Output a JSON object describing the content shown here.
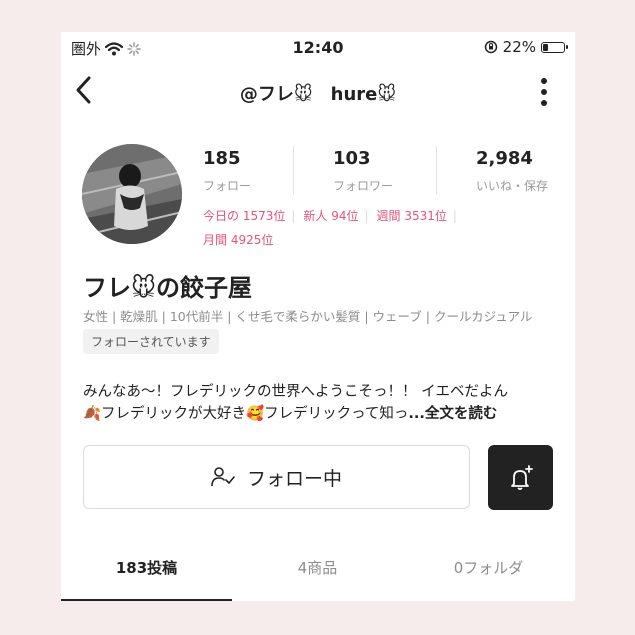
{
  "status_bar": {
    "carrier": "圏外",
    "time": "12:40",
    "battery": "22%",
    "battery_level": 0.22
  },
  "nav": {
    "title": "@フレ🐭　hure🐭",
    "back_icon": "chevron-left-icon",
    "more_icon": "more-vertical-icon"
  },
  "profile": {
    "stats": [
      {
        "num": "185",
        "label": "フォロー"
      },
      {
        "num": "103",
        "label": "フォロワー"
      },
      {
        "num": "2,984",
        "label": "いいね・保存"
      }
    ],
    "ranks": [
      "今日の 1573位",
      "新人 94位",
      "週間 3531位",
      "月間 4925位"
    ],
    "name": "フレ🐭の餃子屋",
    "tags": "女性 | 乾燥肌 | 10代前半 | くせ毛で柔らかい髪質 | ウェーブ | クールカジュアル",
    "follow_badge": "フォローされています",
    "bio_line1": "みんなあ〜！フレデリックの世界へようこそっ！！ イエベだよん",
    "bio_line2": "🍂フレデリックが大好き🥰フレデリックって知っ",
    "bio_more": "...全文を読む",
    "accent_color": "#e8537a"
  },
  "actions": {
    "follow_label": "フォロー中",
    "follow_icon": "user-check-icon",
    "bell_icon": "bell-plus-icon"
  },
  "tabs": [
    {
      "label": "183投稿",
      "active": true
    },
    {
      "label": "4商品",
      "active": false
    },
    {
      "label": "0フォルダ",
      "active": false
    }
  ]
}
